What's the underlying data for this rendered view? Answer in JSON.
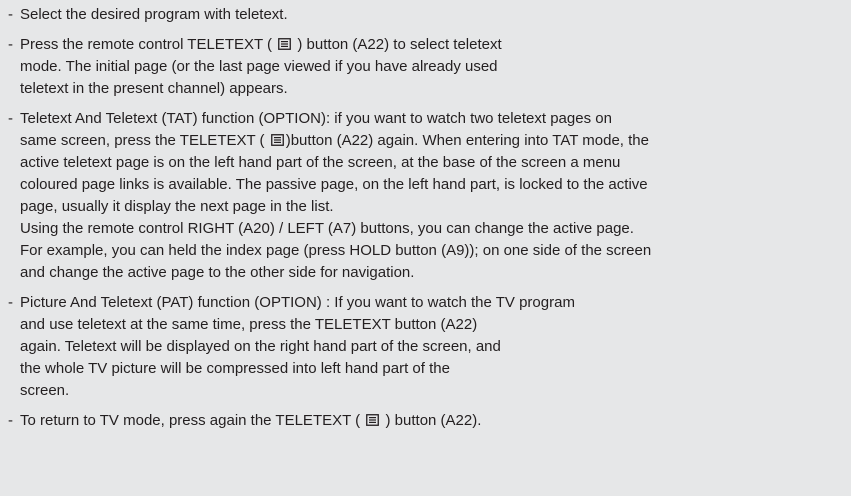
{
  "bullet": "-",
  "icon_name": "teletext-icon",
  "items": [
    {
      "lines": [
        {
          "parts": [
            "Select the desired program with teletext."
          ]
        }
      ]
    },
    {
      "lines": [
        {
          "parts": [
            "Press the remote control TELETEXT (",
            ") button (A22) to select teletext"
          ]
        },
        {
          "parts": [
            "mode. The initial page (or the last page viewed if you have already used"
          ]
        },
        {
          "parts": [
            "teletext in the present channel) appears."
          ]
        }
      ]
    },
    {
      "lines": [
        {
          "parts": [
            "Teletext And Teletext (TAT) function (OPTION): if you want to watch two teletext pages on"
          ]
        },
        {
          "parts": [
            "same screen, press the TELETEXT (",
            ")button (A22) again. When entering into TAT mode, the"
          ]
        },
        {
          "parts": [
            "active teletext page is on the left hand part of the screen, at the base of the screen a menu"
          ]
        },
        {
          "parts": [
            "coloured page links is available. The passive page, on the left hand part, is locked to the active"
          ]
        },
        {
          "parts": [
            "page, usually it display the next page in the list."
          ]
        },
        {
          "parts": [
            "Using the remote control RIGHT (A20) / LEFT (A7) buttons, you can change the active page."
          ]
        },
        {
          "parts": [
            "For example, you can held the index page (press HOLD button (A9)); on one side of the screen"
          ]
        },
        {
          "parts": [
            "and change the active page to the other side for navigation."
          ]
        }
      ]
    },
    {
      "lines": [
        {
          "parts": [
            "Picture And Teletext (PAT) function (OPTION) : If you want to watch the TV program"
          ]
        },
        {
          "parts": [
            "and use teletext at the same time, press the TELETEXT button (A22)"
          ]
        },
        {
          "parts": [
            "again. Teletext will be displayed on the right hand part of the screen, and"
          ]
        },
        {
          "parts": [
            "the whole TV picture will be compressed into left hand part of the"
          ]
        },
        {
          "parts": [
            "screen."
          ]
        }
      ]
    },
    {
      "lines": [
        {
          "parts": [
            "To return to TV mode, press again the TELETEXT (",
            ") button (A22)."
          ]
        }
      ]
    }
  ]
}
